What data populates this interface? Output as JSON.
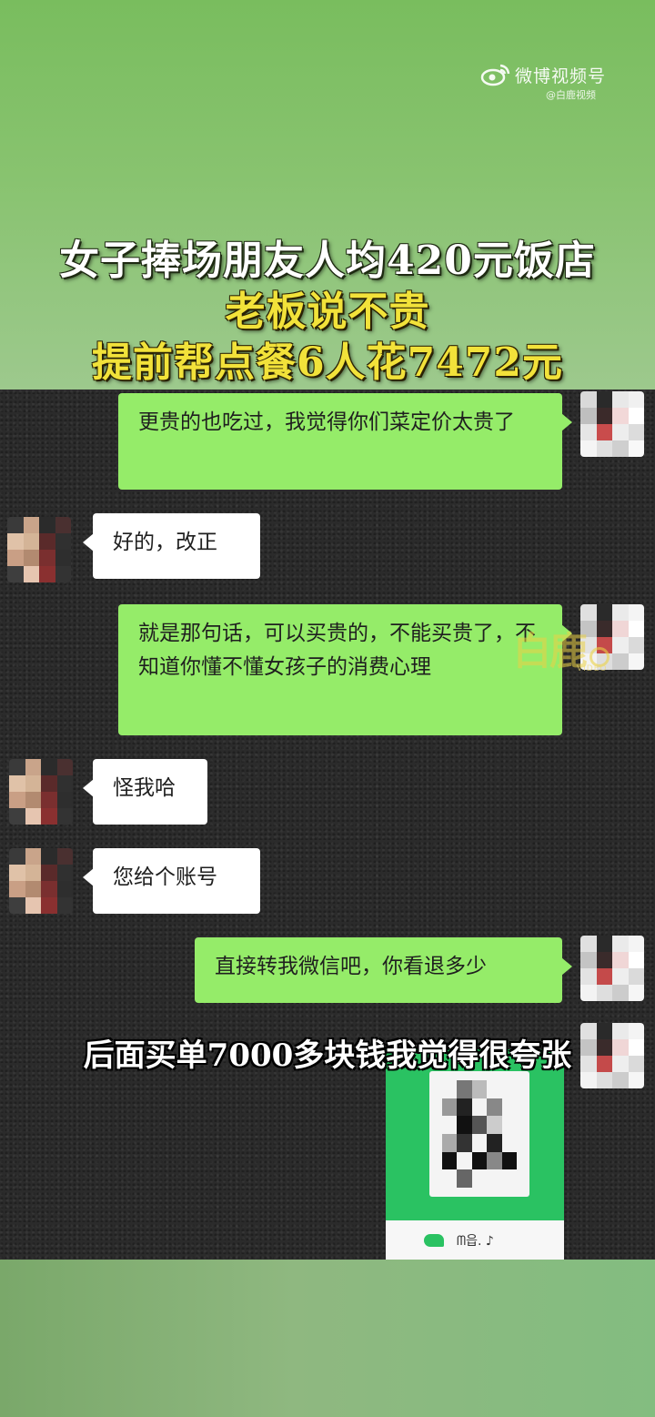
{
  "branding": {
    "platform": "微博视频号",
    "source": "@白鹿视频",
    "watermark": "白鹿",
    "watermark_sub": "VIDEO"
  },
  "headline": {
    "line1": "女子捧场朋友人均420元饭店",
    "line2": "老板说不贵",
    "line3": "提前帮点餐6人花7472元"
  },
  "chat": {
    "messages": [
      {
        "side": "out",
        "text": "更贵的也吃过，我觉得你们菜定价太贵了"
      },
      {
        "side": "in",
        "text": "好的，改正"
      },
      {
        "side": "out",
        "text": "就是那句话，可以买贵的，不能买贵了，不知道你懂不懂女孩子的消费心理"
      },
      {
        "side": "in",
        "text": "怪我哈"
      },
      {
        "side": "in",
        "text": "您给个账号"
      },
      {
        "side": "out",
        "text": "直接转我微信吧，你看退多少"
      }
    ],
    "qr_footer": "ᗰ읍. ♪"
  },
  "subtitle": "后面买单7000多块钱我觉得很夸张",
  "colors": {
    "out_bubble": "#95ec69",
    "in_bubble": "#ffffff",
    "chat_bg": "#2b2b2b",
    "headline_white": "#ffffff",
    "headline_yellow": "#f2e23a",
    "wechat_green": "#2ac262"
  }
}
